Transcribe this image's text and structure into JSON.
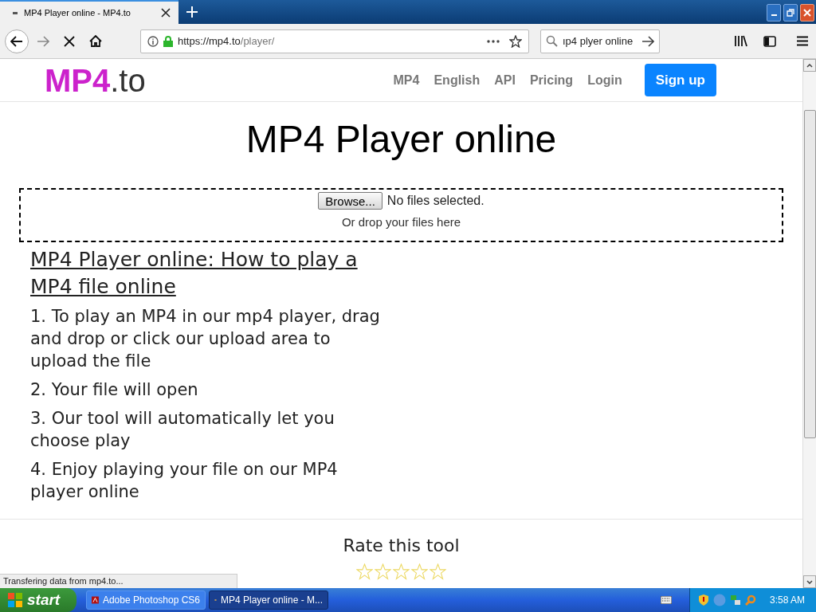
{
  "browser": {
    "tab_title": "MP4 Player online - MP4.to",
    "url_host": "https://mp4.to",
    "url_path": "/player/",
    "search_value": "ıp4 plyer online",
    "status": "Transfering data from mp4.to..."
  },
  "site": {
    "logo_main": "MP4",
    "logo_suffix": ".to",
    "nav": [
      {
        "label": "MP4",
        "kind": "link"
      },
      {
        "label": "English",
        "kind": "link"
      },
      {
        "label": "API",
        "kind": "link"
      },
      {
        "label": "Pricing",
        "kind": "link"
      },
      {
        "label": "Login",
        "kind": "link"
      },
      {
        "label": "Sign up",
        "kind": "button"
      }
    ]
  },
  "page": {
    "title": "MP4 Player online",
    "browse_button": "Browse...",
    "file_status": "No files selected.",
    "drop_hint": "Or drop your files here",
    "howto_heading": "MP4 Player online: How to play a MP4 file online",
    "steps": [
      "1. To play an MP4 in our mp4 player, drag and drop or click our upload area to upload the file",
      "2. Your file will open",
      "3. Our tool will automatically let you choose play",
      "4. Enjoy playing your file on our MP4 player online"
    ],
    "rating": {
      "title": "Rate this tool",
      "stars": 0
    }
  },
  "taskbar": {
    "start": "start",
    "tasks": [
      {
        "label": "Adobe Photoshop CS6",
        "selected": false
      },
      {
        "label": "MP4 Player online - M...",
        "selected": true
      }
    ],
    "clock": "3:58 AM"
  }
}
